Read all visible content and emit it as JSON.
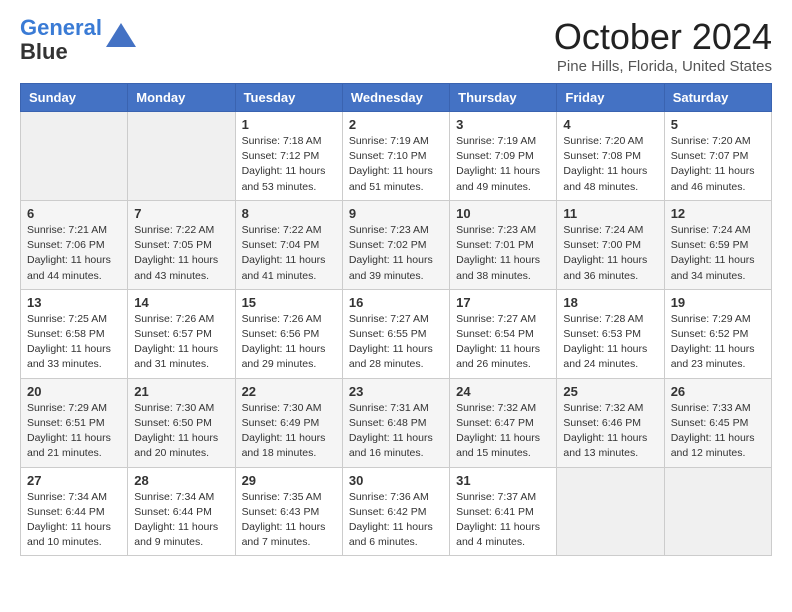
{
  "header": {
    "logo_line1": "General",
    "logo_line2": "Blue",
    "title": "October 2024",
    "subtitle": "Pine Hills, Florida, United States"
  },
  "days_of_week": [
    "Sunday",
    "Monday",
    "Tuesday",
    "Wednesday",
    "Thursday",
    "Friday",
    "Saturday"
  ],
  "weeks": [
    [
      {
        "day": "",
        "empty": true
      },
      {
        "day": "",
        "empty": true
      },
      {
        "day": "1",
        "sunrise": "7:18 AM",
        "sunset": "7:12 PM",
        "daylight": "11 hours and 53 minutes."
      },
      {
        "day": "2",
        "sunrise": "7:19 AM",
        "sunset": "7:10 PM",
        "daylight": "11 hours and 51 minutes."
      },
      {
        "day": "3",
        "sunrise": "7:19 AM",
        "sunset": "7:09 PM",
        "daylight": "11 hours and 49 minutes."
      },
      {
        "day": "4",
        "sunrise": "7:20 AM",
        "sunset": "7:08 PM",
        "daylight": "11 hours and 48 minutes."
      },
      {
        "day": "5",
        "sunrise": "7:20 AM",
        "sunset": "7:07 PM",
        "daylight": "11 hours and 46 minutes."
      }
    ],
    [
      {
        "day": "6",
        "sunrise": "7:21 AM",
        "sunset": "7:06 PM",
        "daylight": "11 hours and 44 minutes."
      },
      {
        "day": "7",
        "sunrise": "7:22 AM",
        "sunset": "7:05 PM",
        "daylight": "11 hours and 43 minutes."
      },
      {
        "day": "8",
        "sunrise": "7:22 AM",
        "sunset": "7:04 PM",
        "daylight": "11 hours and 41 minutes."
      },
      {
        "day": "9",
        "sunrise": "7:23 AM",
        "sunset": "7:02 PM",
        "daylight": "11 hours and 39 minutes."
      },
      {
        "day": "10",
        "sunrise": "7:23 AM",
        "sunset": "7:01 PM",
        "daylight": "11 hours and 38 minutes."
      },
      {
        "day": "11",
        "sunrise": "7:24 AM",
        "sunset": "7:00 PM",
        "daylight": "11 hours and 36 minutes."
      },
      {
        "day": "12",
        "sunrise": "7:24 AM",
        "sunset": "6:59 PM",
        "daylight": "11 hours and 34 minutes."
      }
    ],
    [
      {
        "day": "13",
        "sunrise": "7:25 AM",
        "sunset": "6:58 PM",
        "daylight": "11 hours and 33 minutes."
      },
      {
        "day": "14",
        "sunrise": "7:26 AM",
        "sunset": "6:57 PM",
        "daylight": "11 hours and 31 minutes."
      },
      {
        "day": "15",
        "sunrise": "7:26 AM",
        "sunset": "6:56 PM",
        "daylight": "11 hours and 29 minutes."
      },
      {
        "day": "16",
        "sunrise": "7:27 AM",
        "sunset": "6:55 PM",
        "daylight": "11 hours and 28 minutes."
      },
      {
        "day": "17",
        "sunrise": "7:27 AM",
        "sunset": "6:54 PM",
        "daylight": "11 hours and 26 minutes."
      },
      {
        "day": "18",
        "sunrise": "7:28 AM",
        "sunset": "6:53 PM",
        "daylight": "11 hours and 24 minutes."
      },
      {
        "day": "19",
        "sunrise": "7:29 AM",
        "sunset": "6:52 PM",
        "daylight": "11 hours and 23 minutes."
      }
    ],
    [
      {
        "day": "20",
        "sunrise": "7:29 AM",
        "sunset": "6:51 PM",
        "daylight": "11 hours and 21 minutes."
      },
      {
        "day": "21",
        "sunrise": "7:30 AM",
        "sunset": "6:50 PM",
        "daylight": "11 hours and 20 minutes."
      },
      {
        "day": "22",
        "sunrise": "7:30 AM",
        "sunset": "6:49 PM",
        "daylight": "11 hours and 18 minutes."
      },
      {
        "day": "23",
        "sunrise": "7:31 AM",
        "sunset": "6:48 PM",
        "daylight": "11 hours and 16 minutes."
      },
      {
        "day": "24",
        "sunrise": "7:32 AM",
        "sunset": "6:47 PM",
        "daylight": "11 hours and 15 minutes."
      },
      {
        "day": "25",
        "sunrise": "7:32 AM",
        "sunset": "6:46 PM",
        "daylight": "11 hours and 13 minutes."
      },
      {
        "day": "26",
        "sunrise": "7:33 AM",
        "sunset": "6:45 PM",
        "daylight": "11 hours and 12 minutes."
      }
    ],
    [
      {
        "day": "27",
        "sunrise": "7:34 AM",
        "sunset": "6:44 PM",
        "daylight": "11 hours and 10 minutes."
      },
      {
        "day": "28",
        "sunrise": "7:34 AM",
        "sunset": "6:44 PM",
        "daylight": "11 hours and 9 minutes."
      },
      {
        "day": "29",
        "sunrise": "7:35 AM",
        "sunset": "6:43 PM",
        "daylight": "11 hours and 7 minutes."
      },
      {
        "day": "30",
        "sunrise": "7:36 AM",
        "sunset": "6:42 PM",
        "daylight": "11 hours and 6 minutes."
      },
      {
        "day": "31",
        "sunrise": "7:37 AM",
        "sunset": "6:41 PM",
        "daylight": "11 hours and 4 minutes."
      },
      {
        "day": "",
        "empty": true
      },
      {
        "day": "",
        "empty": true
      }
    ]
  ],
  "labels": {
    "sunrise": "Sunrise:",
    "sunset": "Sunset:",
    "daylight": "Daylight:"
  }
}
